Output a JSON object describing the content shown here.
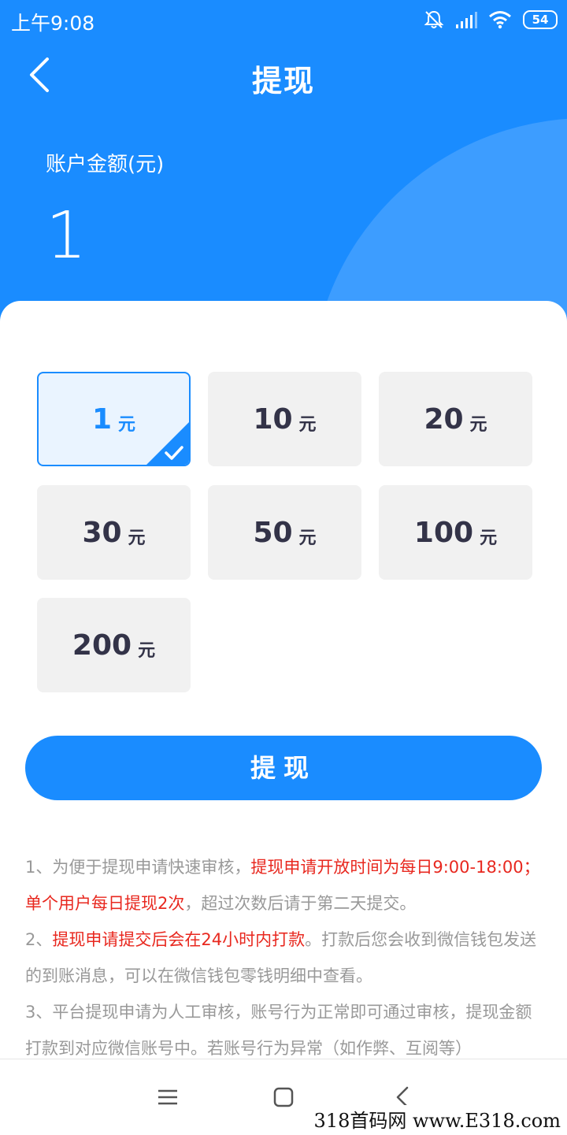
{
  "status_bar": {
    "time": "上午9:08",
    "battery": "54"
  },
  "nav": {
    "title": "提现"
  },
  "balance": {
    "label": "账户金额(元)",
    "value": "1"
  },
  "options": [
    {
      "amount": "1",
      "unit": "元",
      "selected": true
    },
    {
      "amount": "10",
      "unit": "元",
      "selected": false
    },
    {
      "amount": "20",
      "unit": "元",
      "selected": false
    },
    {
      "amount": "30",
      "unit": "元",
      "selected": false
    },
    {
      "amount": "50",
      "unit": "元",
      "selected": false
    },
    {
      "amount": "100",
      "unit": "元",
      "selected": false
    },
    {
      "amount": "200",
      "unit": "元",
      "selected": false
    }
  ],
  "withdraw_button": "提现",
  "notes": {
    "n1_a": "1、为便于提现申请快速审核，",
    "n1_b": "提现申请开放时间为每日9:00-18:00；单个用户每日提现2次",
    "n1_c": "，超过次数后请于第二天提交。",
    "n2_a": "2、",
    "n2_b": "提现申请提交后会在24小时内打款",
    "n2_c": "。打款后您会收到微信钱包发送的到账消息，可以在微信钱包零钱明细中查看。",
    "n3": "3、平台提现申请为人工审核，账号行为正常即可通过审核，提现金额打款到对应微信账号中。若账号行为异常（如作弊、互阅等）"
  },
  "watermark": "318首码网 www.E318.com",
  "colors": {
    "primary": "#1a8cff",
    "red": "#e8281f",
    "note_gray": "#999999"
  }
}
